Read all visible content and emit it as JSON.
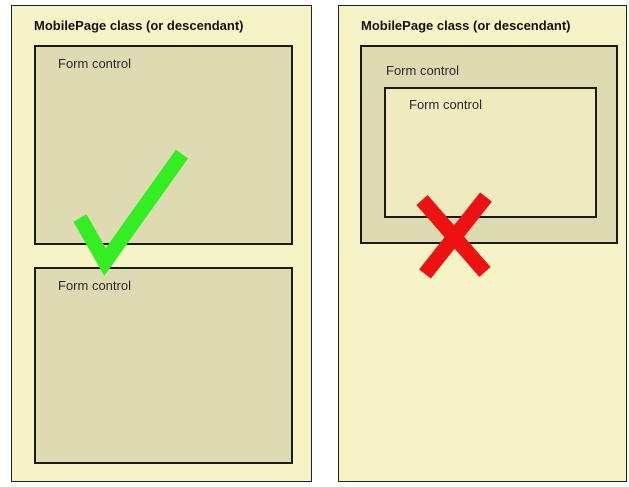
{
  "left_panel": {
    "title": "MobilePage class (or descendant)",
    "controls": [
      {
        "label": "Form control"
      },
      {
        "label": "Form control"
      }
    ],
    "mark": "check-icon",
    "mark_color": "#33ee22"
  },
  "right_panel": {
    "title": "MobilePage class (or descendant)",
    "outer_control": {
      "label": "Form control"
    },
    "inner_control": {
      "label": "Form control"
    },
    "mark": "x-icon",
    "mark_color": "#ee1111"
  },
  "colors": {
    "page_background": "#f6f3c6",
    "control_background": "#dedab1",
    "nested_control_background": "#efebbf",
    "border": "#1a1a1a"
  }
}
